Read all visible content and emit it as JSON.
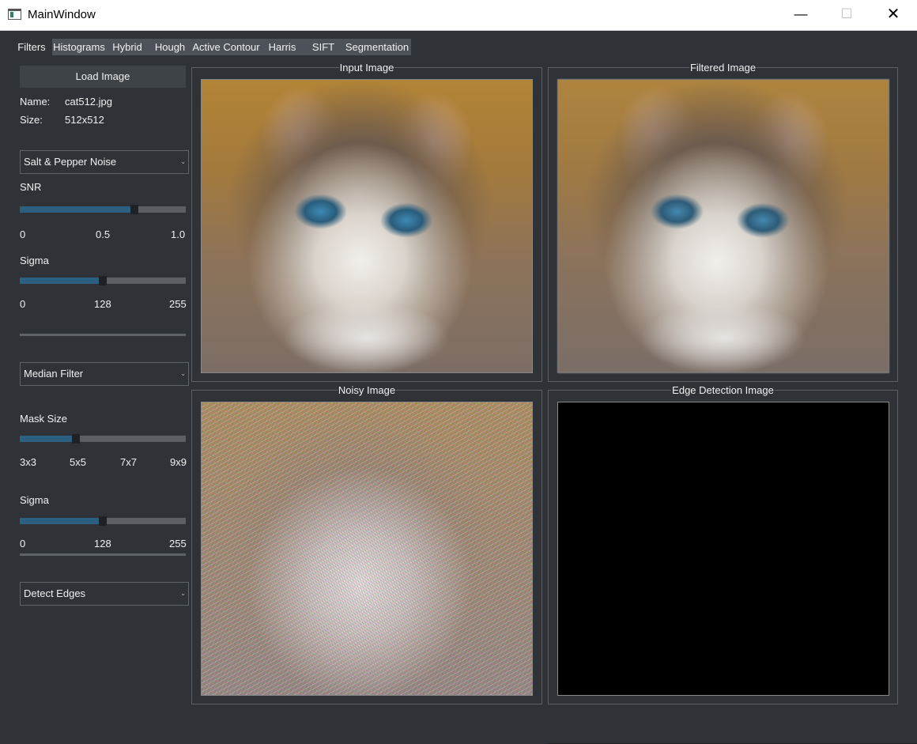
{
  "window": {
    "title": "MainWindow",
    "minimize": "—",
    "maximize": "☐",
    "close": "✕"
  },
  "tabs": [
    "Filters",
    "Histograms",
    "Hybrid",
    "Hough",
    "Active Contour",
    "Harris",
    "SIFT",
    "Segmentation"
  ],
  "left": {
    "load_button": "Load Image",
    "name_label": "Name:",
    "name_value": "cat512.jpg",
    "size_label": "Size:",
    "size_value": "512x512",
    "noise_combo": "Salt & Pepper Noise",
    "snr": {
      "label": "SNR",
      "value": 0.7,
      "ticks": [
        "0",
        "0.5",
        "1.0"
      ]
    },
    "sigma1": {
      "label": "Sigma",
      "value": 0.5,
      "ticks": [
        "0",
        "128",
        "255"
      ]
    },
    "filter_combo": "Median Filter",
    "mask": {
      "label": "Mask Size",
      "value": 0.33,
      "ticks": [
        "3x3",
        "5x5",
        "7x7",
        "9x9"
      ]
    },
    "sigma2": {
      "label": "Sigma",
      "value": 0.5,
      "ticks": [
        "0",
        "128",
        "255"
      ]
    },
    "edge_combo": "Detect Edges"
  },
  "panels": {
    "input": "Input Image",
    "filtered": "Filtered Image",
    "noisy": "Noisy Image",
    "edge": "Edge Detection Image"
  },
  "colors": {
    "background": "#2f3338",
    "slider_fill": "#2c5f80",
    "tab_bg": "#4d5258"
  }
}
